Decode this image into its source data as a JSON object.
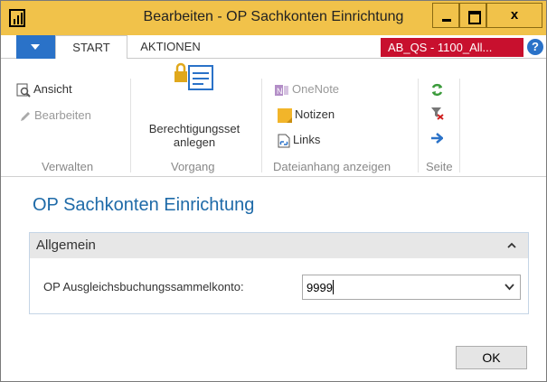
{
  "window": {
    "title": "Bearbeiten - OP Sachkonten Einrichtung",
    "close_glyph": "x"
  },
  "tabs": [
    {
      "label": "START",
      "active": true
    },
    {
      "label": "AKTIONEN",
      "active": false
    }
  ],
  "company": "AB_QS - 1100_All...",
  "help": "?",
  "ribbon": {
    "verwalten": {
      "label": "Verwalten",
      "ansicht": "Ansicht",
      "bearbeiten": "Bearbeiten"
    },
    "vorgang": {
      "label": "Vorgang",
      "berechtigungsset_line1": "Berechtigungsset",
      "berechtigungsset_line2": "anlegen"
    },
    "dateianhang": {
      "label": "Dateianhang anzeigen",
      "onenote": "OneNote",
      "notizen": "Notizen",
      "links": "Links"
    },
    "seite": {
      "label": "Seite"
    }
  },
  "page": {
    "title": "OP Sachkonten Einrichtung",
    "fasttab": {
      "title": "Allgemein",
      "field_label": "OP Ausgleichsbuchungssammelkonto:",
      "field_value": "9999"
    }
  },
  "ok_label": "OK",
  "colors": {
    "titlebar": "#f1c24a",
    "accent_blue": "#2a72c8",
    "company_red": "#c8102e",
    "page_title": "#1e6aa8"
  }
}
